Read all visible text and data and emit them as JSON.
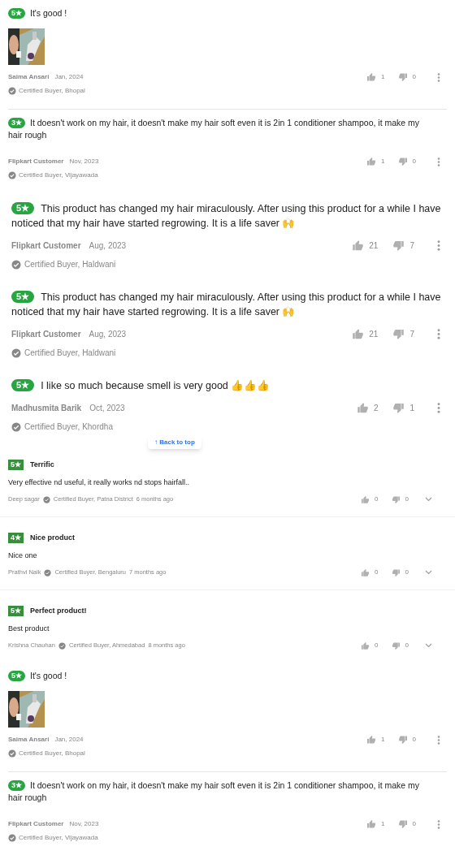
{
  "reviews": [
    {
      "kind": "small",
      "rating": "5★",
      "title": "It's good !",
      "name": "Saima Ansari",
      "date": "Jan, 2024",
      "location": "Certified Buyer, Bhopal",
      "likes": "1",
      "dislikes": "0",
      "divider": true
    },
    {
      "kind": "small",
      "rating": "3★",
      "title": "It doesn't work on my hair, it doesn't make my hair soft even it is 2in 1 conditioner shampoo, it make my hair rough",
      "name": "Flipkart Customer",
      "date": "Nov, 2023",
      "location": "Certified Buyer, Vijayawada",
      "likes": "1",
      "dislikes": "0",
      "divider": false
    },
    {
      "kind": "large",
      "rating": "5★",
      "title": "This product has changed my hair miraculously. After using this product for a while I have noticed that my hair have started regrowing. It is a life saver 🙌",
      "name": "Flipkart Customer",
      "date": "Aug, 2023",
      "location": "Certified Buyer, Haldwani",
      "likes": "21",
      "dislikes": "7",
      "divider": false
    },
    {
      "kind": "large",
      "rating": "5★",
      "title": "This product has changed my hair miraculously. After using this product for a while I have noticed that my hair have started regrowing. It is a life saver 🙌",
      "name": "Flipkart Customer",
      "date": "Aug, 2023",
      "location": "Certified Buyer, Haldwani",
      "likes": "21",
      "dislikes": "7",
      "divider": false
    },
    {
      "kind": "large",
      "rating": "5★",
      "title": "I like so much because smell is very good 👍👍👍",
      "name": "Madhusmita Barik",
      "date": "Oct, 2023",
      "location": "Certified Buyer, Khordha",
      "likes": "2",
      "dislikes": "1",
      "divider": false
    },
    {
      "kind": "flat",
      "rating": "5★",
      "title": "Terrific",
      "body": "Very effective nd useful, it really works nd stops hairfall..",
      "name": "Deep sagar",
      "location": "Certified Buyer, Patna District",
      "date": "6 months ago",
      "likes": "0",
      "dislikes": "0",
      "divider": true
    },
    {
      "kind": "flat",
      "rating": "4★",
      "title": "Nice product",
      "body": "Nice one",
      "name": "Prathvi Naik",
      "location": "Certified Buyer, Bengaluru",
      "date": "7 months ago",
      "likes": "0",
      "dislikes": "0",
      "divider": true
    },
    {
      "kind": "flat",
      "rating": "5★",
      "title": "Perfect product!",
      "body": "Best product",
      "name": "Krishna Chauhan",
      "location": "Certified Buyer, Ahmedabad",
      "date": "8 months ago",
      "likes": "0",
      "dislikes": "0",
      "divider": false
    },
    {
      "kind": "small",
      "rating": "5★",
      "title": "It's good !",
      "name": "Saima Ansari",
      "date": "Jan, 2024",
      "location": "Certified Buyer, Bhopal",
      "likes": "1",
      "dislikes": "0",
      "divider": true
    },
    {
      "kind": "small",
      "rating": "3★",
      "title": "It doesn't work on my hair, it doesn't make my hair soft even it is 2in 1 conditioner shampoo, it make my hair rough",
      "name": "Flipkart Customer",
      "date": "Nov, 2023",
      "location": "Certified Buyer, Vijayawada",
      "likes": "1",
      "dislikes": "0",
      "divider": false
    }
  ],
  "back_to_top": {
    "label": "↑ Back to top"
  }
}
